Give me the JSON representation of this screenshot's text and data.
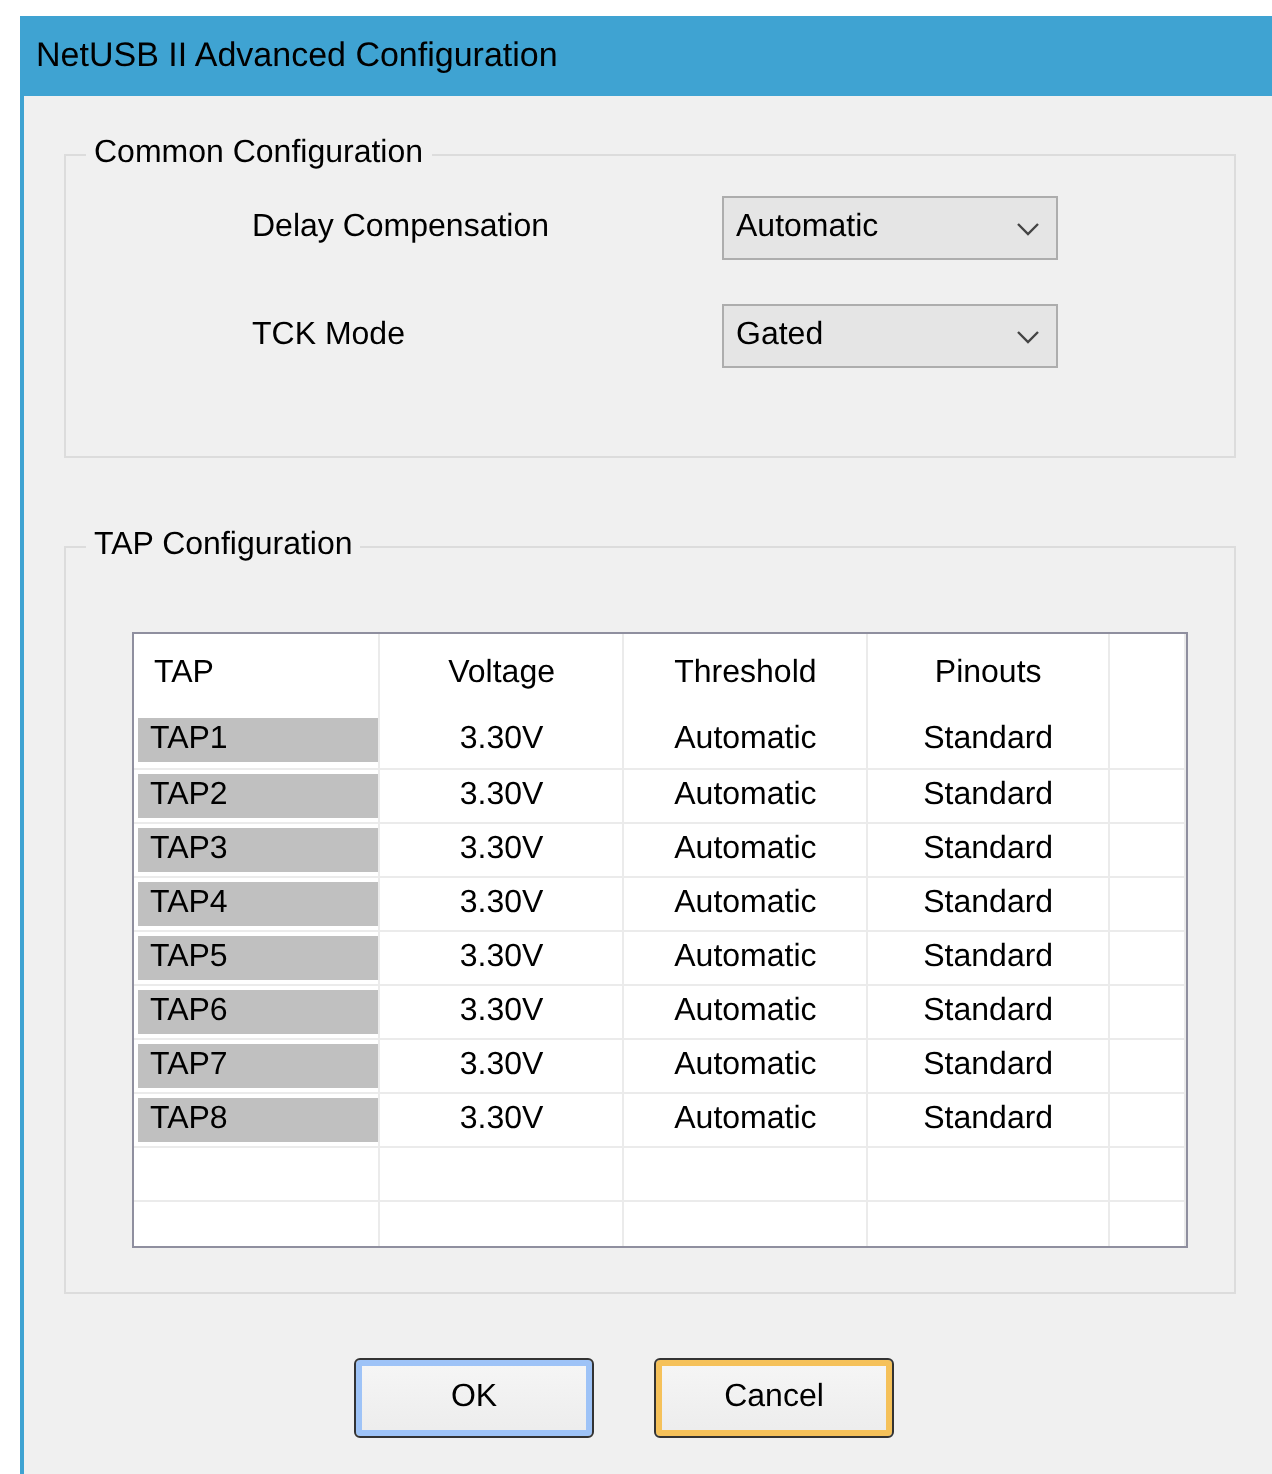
{
  "window": {
    "title": "NetUSB II Advanced Configuration"
  },
  "common_configuration": {
    "title": "Common Configuration",
    "fields": [
      {
        "label": "Delay Compensation",
        "value": "Automatic"
      },
      {
        "label": "TCK Mode",
        "value": "Gated"
      }
    ]
  },
  "tap_configuration": {
    "title": "TAP Configuration",
    "table": {
      "columns": [
        "TAP",
        "Voltage",
        "Threshold",
        "Pinouts"
      ],
      "rows": [
        [
          "TAP1",
          "3.30V",
          "Automatic",
          "Standard"
        ],
        [
          "TAP2",
          "3.30V",
          "Automatic",
          "Standard"
        ],
        [
          "TAP3",
          "3.30V",
          "Automatic",
          "Standard"
        ],
        [
          "TAP4",
          "3.30V",
          "Automatic",
          "Standard"
        ],
        [
          "TAP5",
          "3.30V",
          "Automatic",
          "Standard"
        ],
        [
          "TAP6",
          "3.30V",
          "Automatic",
          "Standard"
        ],
        [
          "TAP7",
          "3.30V",
          "Automatic",
          "Standard"
        ],
        [
          "TAP8",
          "3.30V",
          "Automatic",
          "Standard"
        ]
      ]
    }
  },
  "buttons": [
    {
      "label": "OK",
      "default": true,
      "hovered": false
    },
    {
      "label": "Cancel",
      "default": false,
      "hovered": true
    }
  ]
}
